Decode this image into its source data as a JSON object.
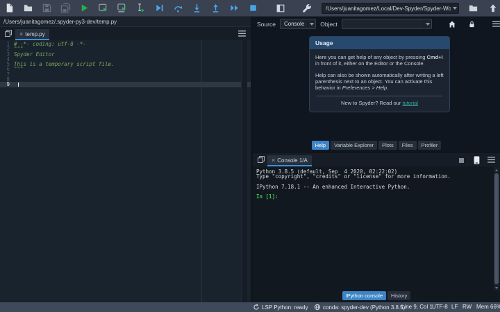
{
  "colors": {
    "accent_blue": "#3d84c6",
    "run_green": "#21b04b",
    "debug_blue": "#4aa3e8",
    "link_teal": "#32ac9e",
    "code_green": "#7ca65c",
    "prompt_green": "#45c554",
    "toolbar_bg": "#3a4150",
    "editor_bg": "#19232d",
    "statusbar_bg": "#3e4a59"
  },
  "toolbar": {
    "icons": [
      "new-file",
      "open-file",
      "save-file",
      "save-all",
      "run-file",
      "run-cell",
      "run-cell-and-advance",
      "run-selection",
      "debug-file",
      "step-over",
      "step-into",
      "step-return",
      "continue-execution",
      "stop-debugging",
      "maximize-pane",
      "preferences",
      "python-path-manager",
      "browse-working-directory",
      "go-to-parent-directory"
    ],
    "working_directory": "/Users/juanitagomez/Local/Dev-Spyder/Spyder-Workshop"
  },
  "editor": {
    "path": "/Users/juanitagomez/.spyder-py3-dev/temp.py",
    "tab": {
      "label": "temp.py",
      "close": "×"
    },
    "line_numbers": [
      "1",
      "2",
      "3",
      "4",
      "5",
      "6",
      "7",
      "8",
      "9"
    ],
    "lines": [
      "# -*- coding: utf-8 -*-",
      "\"\"\"",
      "Spyder Editor",
      "",
      "This is a temporary script file.",
      "\"\"\"",
      "",
      "",
      ""
    ]
  },
  "help": {
    "source_label": "Source",
    "source_value": "Console",
    "object_label": "Object",
    "object_value": "",
    "usage": {
      "title": "Usage",
      "p1_pre": "Here you can get help of any object by pressing ",
      "p1_bold": "Cmd+I",
      "p1_post": " in front of it, either on the Editor or the Console.",
      "p2_pre": "Help can also be shown automatically after writing a left parenthesis next to an object. You can activate this behavior in ",
      "p2_italic": "Preferences > Help",
      "p2_post": ".",
      "footer_pre": "New to Spyder? Read our ",
      "footer_link": "tutorial"
    },
    "tabs": [
      {
        "label": "Help",
        "active": true
      },
      {
        "label": "Variable Explorer",
        "active": false
      },
      {
        "label": "Plots",
        "active": false
      },
      {
        "label": "Files",
        "active": false
      },
      {
        "label": "Profiler",
        "active": false
      }
    ]
  },
  "console": {
    "tab": {
      "label": "Console 1/A",
      "close": "×"
    },
    "lines": [
      "Python 3.8.5 (default, Sep  4 2020, 02:22:02)",
      "Type \"copyright\", \"credits\" or \"license\" for more information.",
      "",
      "IPython 7.18.1 -- An enhanced Interactive Python.",
      ""
    ],
    "prompt": "In [1]:",
    "bottom_tabs": [
      {
        "label": "IPython console",
        "active": true
      },
      {
        "label": "History",
        "active": false
      }
    ]
  },
  "statusbar": {
    "lsp": "LSP Python: ready",
    "conda": "conda: spyder-dev (Python 3.8.5)",
    "cursor": "Line 9, Col 1",
    "encoding": "UTF-8",
    "eol": "LF",
    "permissions": "RW",
    "memory": "Mem 66%"
  }
}
